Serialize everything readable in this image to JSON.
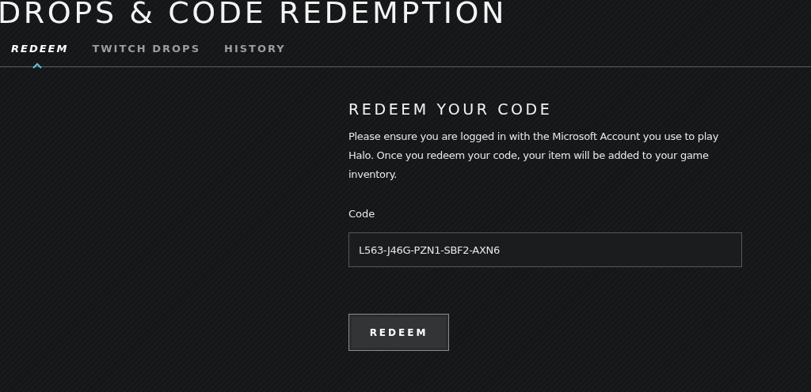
{
  "page_title": "DROPS & CODE REDEMPTION",
  "tabs": [
    {
      "label": "REDEEM",
      "selected": true
    },
    {
      "label": "TWITCH DROPS",
      "selected": false
    },
    {
      "label": "HISTORY",
      "selected": false
    }
  ],
  "form": {
    "heading": "REDEEM YOUR CODE",
    "description": "Please ensure you are logged in with the Microsoft Account you use to play Halo. Once you redeem your code, your item will be added to your game inventory.",
    "field_label": "Code",
    "value": "L563-J46G-PZN1-SBF2-AXN6",
    "button": "REDEEM"
  }
}
